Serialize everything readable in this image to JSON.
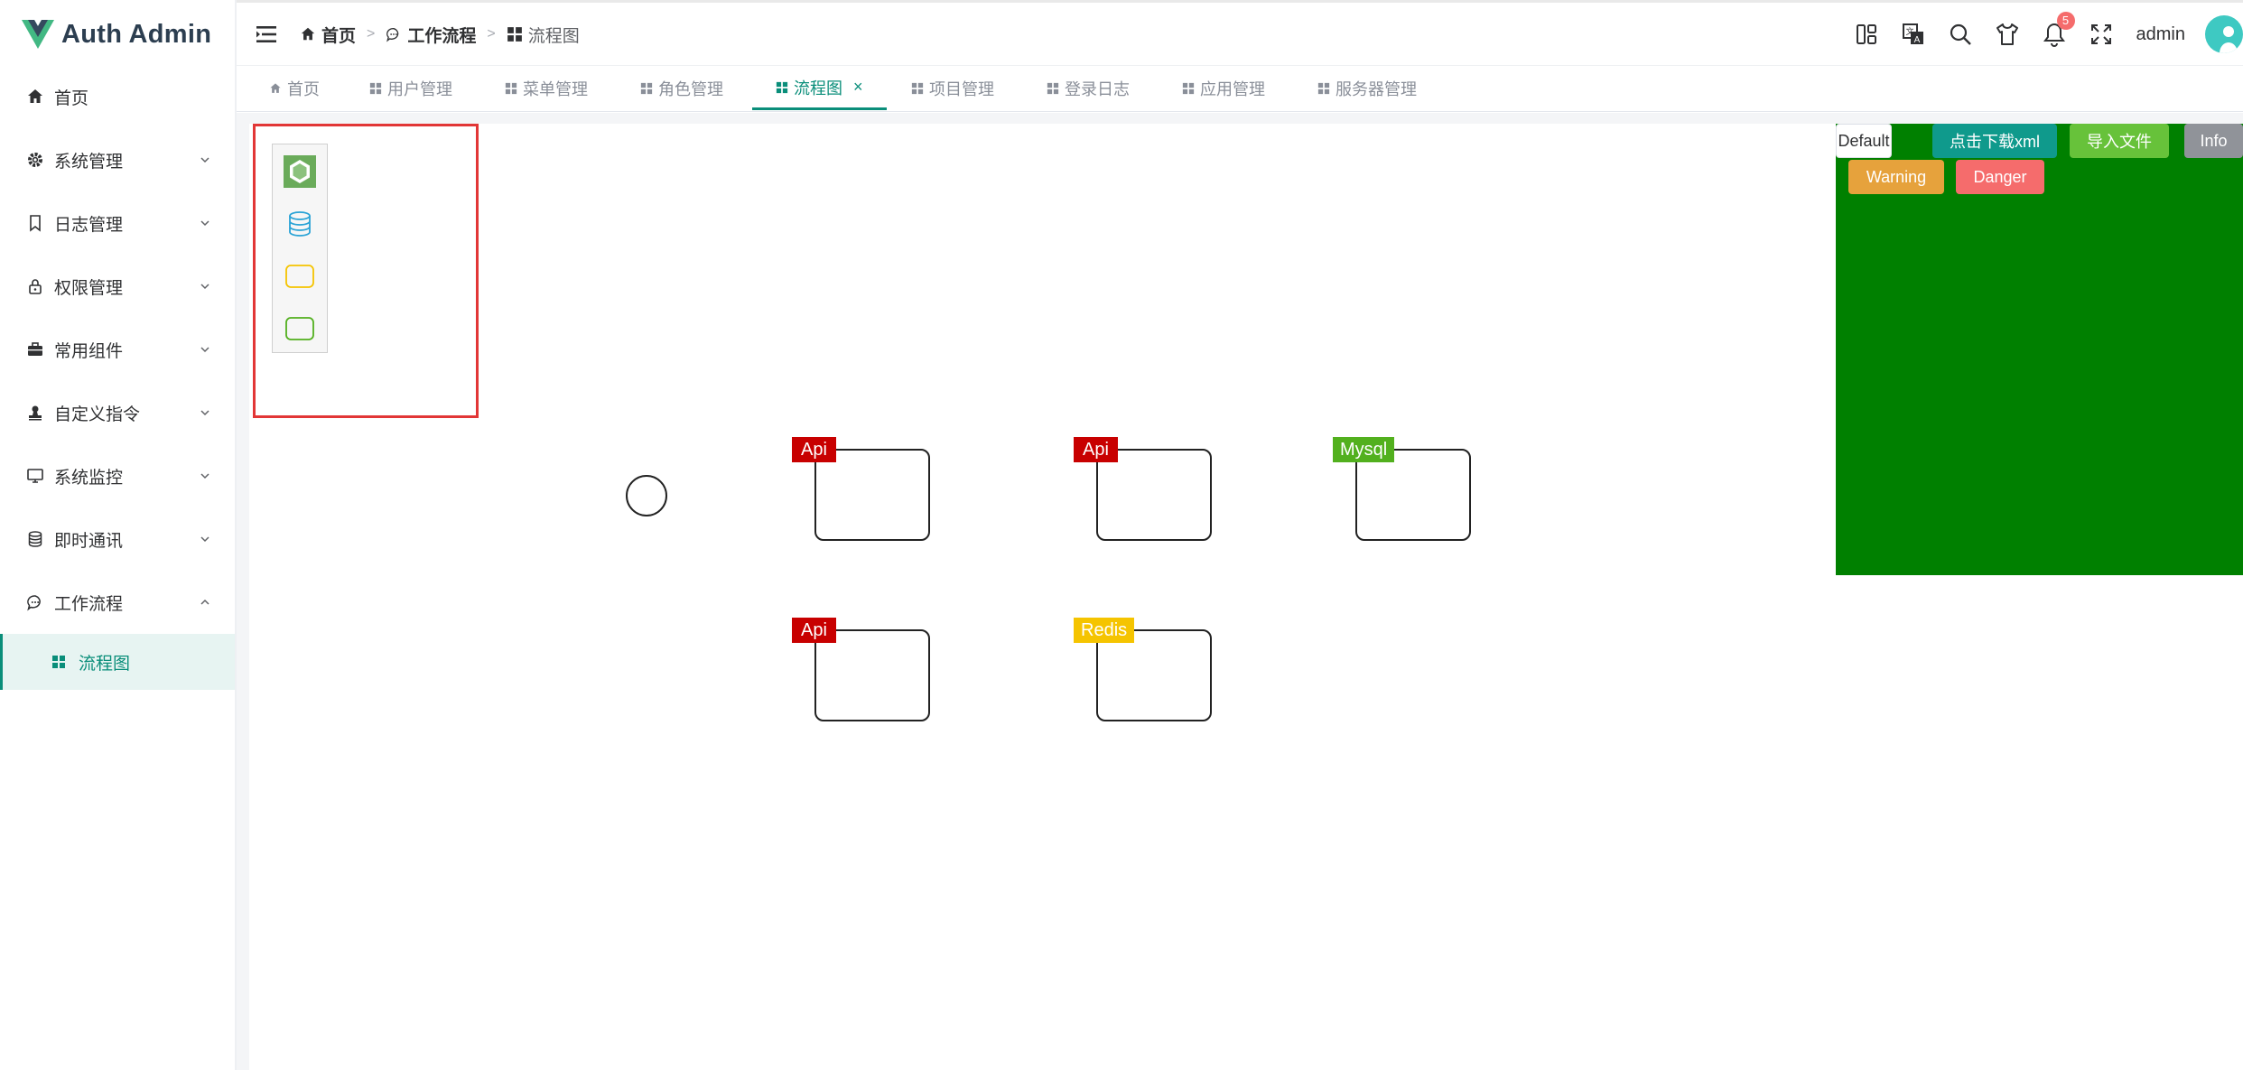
{
  "app": {
    "title": "Auth Admin"
  },
  "sidebar": {
    "items": [
      {
        "label": "首页",
        "icon": "home-icon",
        "expandable": false
      },
      {
        "label": "系统管理",
        "icon": "gear-icon",
        "expandable": true
      },
      {
        "label": "日志管理",
        "icon": "bookmark-icon",
        "expandable": true
      },
      {
        "label": "权限管理",
        "icon": "lock-icon",
        "expandable": true
      },
      {
        "label": "常用组件",
        "icon": "briefcase-icon",
        "expandable": true
      },
      {
        "label": "自定义指令",
        "icon": "stamp-icon",
        "expandable": true
      },
      {
        "label": "系统监控",
        "icon": "monitor-icon",
        "expandable": true
      },
      {
        "label": "即时通讯",
        "icon": "database-icon",
        "expandable": true
      },
      {
        "label": "工作流程",
        "icon": "chat-icon",
        "expandable": true,
        "expanded": true
      }
    ],
    "sub_item": {
      "label": "流程图",
      "icon": "grid-icon",
      "active": true
    }
  },
  "header": {
    "breadcrumb": [
      {
        "label": "首页",
        "icon": "home-icon"
      },
      {
        "label": "工作流程",
        "icon": "chat-icon"
      },
      {
        "label": "流程图",
        "icon": "grid-icon"
      }
    ],
    "notification_count": "5",
    "username": "admin"
  },
  "tabs": [
    {
      "label": "首页",
      "icon": "home-icon",
      "active": false
    },
    {
      "label": "用户管理",
      "icon": "grid-icon",
      "active": false
    },
    {
      "label": "菜单管理",
      "icon": "grid-icon",
      "active": false
    },
    {
      "label": "角色管理",
      "icon": "grid-icon",
      "active": false
    },
    {
      "label": "流程图",
      "icon": "grid-icon",
      "active": true,
      "closable": true
    },
    {
      "label": "项目管理",
      "icon": "grid-icon",
      "active": false
    },
    {
      "label": "登录日志",
      "icon": "grid-icon",
      "active": false
    },
    {
      "label": "应用管理",
      "icon": "grid-icon",
      "active": false
    },
    {
      "label": "服务器管理",
      "icon": "grid-icon",
      "active": false
    }
  ],
  "palette": {
    "items": [
      {
        "icon": "hexagon-logo-icon"
      },
      {
        "icon": "database-icon"
      },
      {
        "icon": "yellow-rect-icon"
      },
      {
        "icon": "green-rect-icon"
      }
    ]
  },
  "diagram": {
    "nodes": [
      {
        "tag": "Api",
        "tag_color": "#c80000"
      },
      {
        "tag": "Api",
        "tag_color": "#c80000"
      },
      {
        "tag": "Mysql",
        "tag_color": "#52b01e"
      },
      {
        "tag": "Api",
        "tag_color": "#c80000"
      },
      {
        "tag": "Redis",
        "tag_color": "#f5c400"
      }
    ]
  },
  "right_panel": {
    "background": "#008000",
    "buttons": [
      {
        "label": "Default",
        "color": "#ffffff",
        "text_color": "#303133"
      },
      {
        "label": "点击下载xml",
        "color": "#0f9a8c",
        "text_color": "#ffffff"
      },
      {
        "label": "导入文件",
        "color": "#67c23a",
        "text_color": "#ffffff"
      },
      {
        "label": "Info",
        "color": "#909399",
        "text_color": "#ffffff"
      },
      {
        "label": "Warning",
        "color": "#e6a23c",
        "text_color": "#ffffff"
      },
      {
        "label": "Danger",
        "color": "#f56c6c",
        "text_color": "#ffffff"
      }
    ]
  },
  "colors": {
    "accent": "#0a8e7a",
    "palette_frame": "#e23636"
  }
}
